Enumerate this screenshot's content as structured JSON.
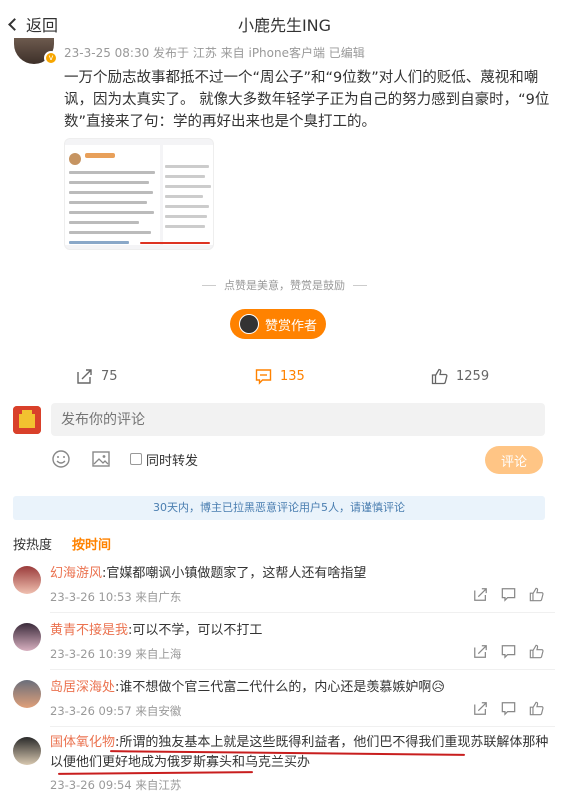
{
  "header": {
    "back_label": "返回",
    "title": "小鹿先生ING"
  },
  "post": {
    "meta": "23-3-25 08:30 发布于 江苏  来自 iPhone客户端 已编辑",
    "text": "一万个励志故事都抵不过一个“周公子”和“9位数”对人们的贬低、蔑视和嘲讽，因为太真实了。 就像大多数年轻学子正为自己的努力感到自豪时，“9位数”直接来了句：学的再好出来也是个臭打工的。"
  },
  "reward": {
    "hint": "点赞是美意，赞赏是鼓励",
    "button_label": "赞赏作者"
  },
  "actions": {
    "repost_count": "75",
    "comment_count": "135",
    "like_count": "1259"
  },
  "composer": {
    "placeholder": "发布你的评论",
    "repost_label": "同时转发",
    "submit_label": "评论"
  },
  "notice": "30天内，博主已拉黑恶意评论用户5人，请谨慎评论",
  "sort": {
    "hot_label": "按热度",
    "time_label": "按时间"
  },
  "comments": [
    {
      "name": "幻海游风",
      "text": ":官媒都嘲讽小镇做题家了，这帮人还有啥指望",
      "meta": "23-3-26 10:53 来自广东"
    },
    {
      "name": "黄青不接是我",
      "text": ":可以不学，可以不打工",
      "meta": "23-3-26 10:39 来自上海"
    },
    {
      "name": "岛居深海处",
      "text": ":谁不想做个官三代富二代什么的，内心还是羡慕嫉妒啊😥",
      "meta": "23-3-26 09:57 来自安徽"
    },
    {
      "name": "国体氧化物",
      "text": ":所谓的独友基本上就是这些既得利益者，他们巴不得我们重现苏联解体那种以便他们更好地成为俄罗斯寡头和乌克兰买办",
      "meta": "23-3-26 09:54 来自江苏"
    }
  ],
  "colors": {
    "accent": "#ff8200",
    "name": "#eb7350",
    "link_blue": "#4a7eb0"
  }
}
